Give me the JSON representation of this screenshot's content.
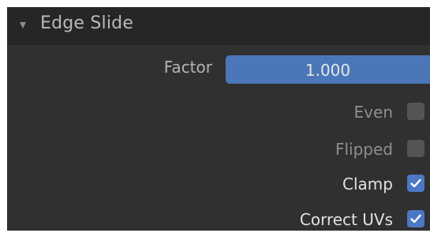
{
  "panel": {
    "title": "Edge Slide",
    "expanded_icon": "triangle-down-icon"
  },
  "factor": {
    "label": "Factor",
    "value": "1.000"
  },
  "options": [
    {
      "label": "Even",
      "checked": false
    },
    {
      "label": "Flipped",
      "checked": false
    },
    {
      "label": "Clamp",
      "checked": true
    },
    {
      "label": "Correct UVs",
      "checked": true
    }
  ],
  "colors": {
    "accent": "#4b77b9",
    "checkbox_on": "#4a78c4",
    "checkbox_off": "#545454",
    "panel_bg": "#303030",
    "header_bg": "#262626"
  }
}
